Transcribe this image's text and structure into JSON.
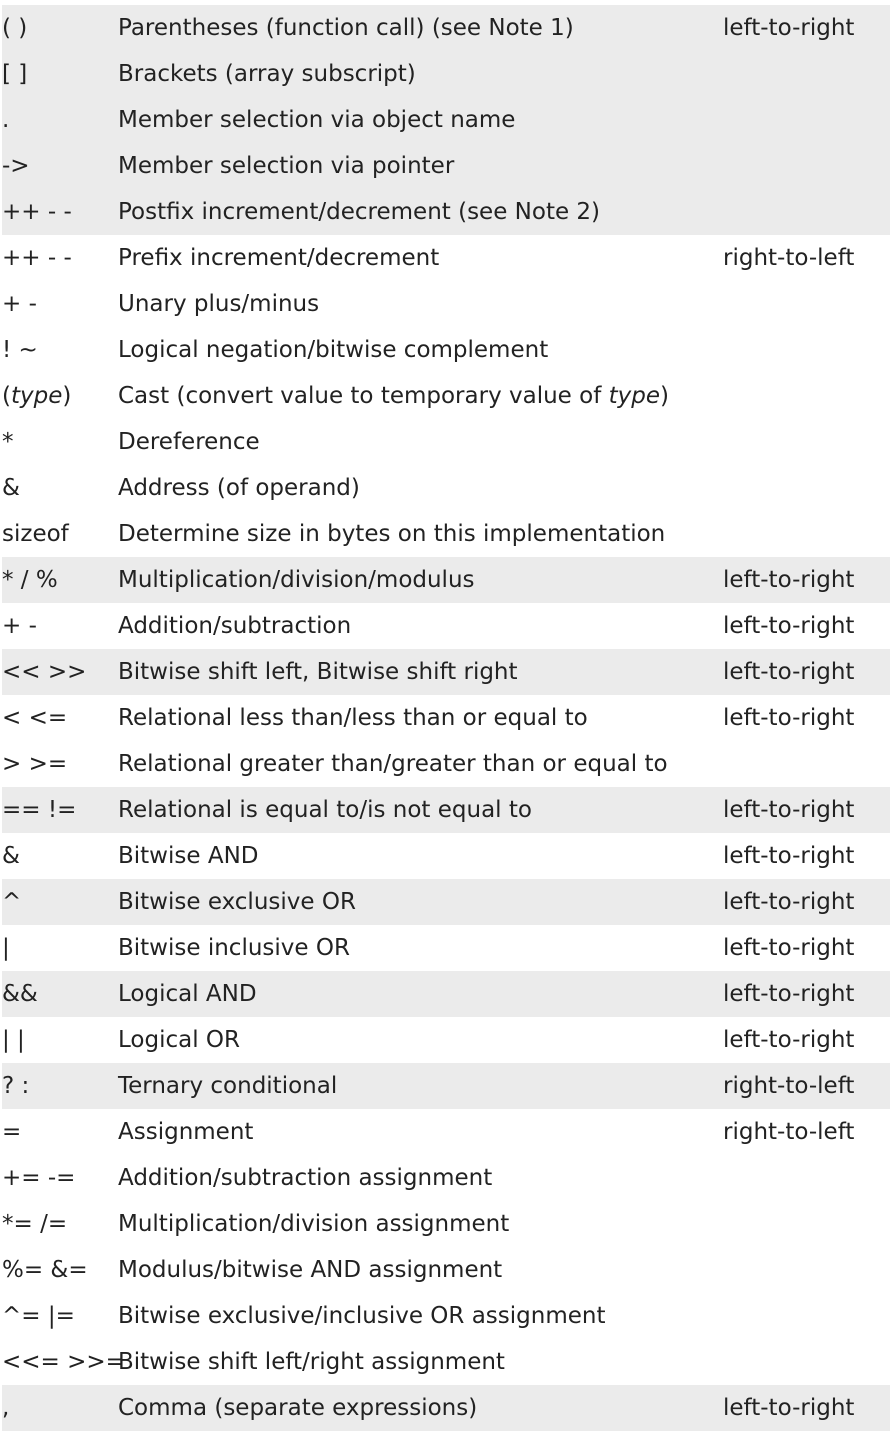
{
  "rows": [
    {
      "op": [
        {
          "t": "( )"
        }
      ],
      "desc": [
        {
          "t": "Parentheses (function call) (see Note 1)"
        }
      ],
      "assoc": "left-to-right",
      "shaded": true
    },
    {
      "op": [
        {
          "t": "[ ]"
        }
      ],
      "desc": [
        {
          "t": "Brackets (array subscript)"
        }
      ],
      "assoc": "",
      "shaded": true
    },
    {
      "op": [
        {
          "t": "."
        }
      ],
      "desc": [
        {
          "t": "Member selection via object name"
        }
      ],
      "assoc": "",
      "shaded": true
    },
    {
      "op": [
        {
          "t": "->"
        }
      ],
      "desc": [
        {
          "t": "Member selection via pointer"
        }
      ],
      "assoc": "",
      "shaded": true
    },
    {
      "op": [
        {
          "t": "++ - -"
        }
      ],
      "desc": [
        {
          "t": "Postfix increment/decrement (see Note 2)"
        }
      ],
      "assoc": "",
      "shaded": true
    },
    {
      "op": [
        {
          "t": "++ - -"
        }
      ],
      "desc": [
        {
          "t": "Prefix increment/decrement"
        }
      ],
      "assoc": "right-to-left",
      "shaded": false
    },
    {
      "op": [
        {
          "t": "+ -"
        }
      ],
      "desc": [
        {
          "t": "Unary plus/minus"
        }
      ],
      "assoc": "",
      "shaded": false
    },
    {
      "op": [
        {
          "t": "! ~"
        }
      ],
      "desc": [
        {
          "t": "Logical negation/bitwise complement"
        }
      ],
      "assoc": "",
      "shaded": false
    },
    {
      "op": [
        {
          "t": "("
        },
        {
          "t": "type",
          "i": true
        },
        {
          "t": ")"
        }
      ],
      "desc": [
        {
          "t": "Cast (convert value to temporary value of "
        },
        {
          "t": "type",
          "i": true
        },
        {
          "t": ")"
        }
      ],
      "assoc": "",
      "shaded": false
    },
    {
      "op": [
        {
          "t": "*"
        }
      ],
      "desc": [
        {
          "t": "Dereference"
        }
      ],
      "assoc": "",
      "shaded": false
    },
    {
      "op": [
        {
          "t": "&"
        }
      ],
      "desc": [
        {
          "t": "Address (of operand)"
        }
      ],
      "assoc": "",
      "shaded": false
    },
    {
      "op": [
        {
          "t": "sizeof"
        }
      ],
      "desc": [
        {
          "t": "Determine size in bytes on this implementation"
        }
      ],
      "assoc": "",
      "shaded": false
    },
    {
      "op": [
        {
          "t": "* / %"
        }
      ],
      "desc": [
        {
          "t": "Multiplication/division/modulus"
        }
      ],
      "assoc": "left-to-right",
      "shaded": true
    },
    {
      "op": [
        {
          "t": "+ -"
        }
      ],
      "desc": [
        {
          "t": "Addition/subtraction"
        }
      ],
      "assoc": "left-to-right",
      "shaded": false
    },
    {
      "op": [
        {
          "t": "<< >>"
        }
      ],
      "desc": [
        {
          "t": "Bitwise shift left, Bitwise shift right"
        }
      ],
      "assoc": "left-to-right",
      "shaded": true
    },
    {
      "op": [
        {
          "t": "< <="
        }
      ],
      "desc": [
        {
          "t": "Relational less than/less than or equal to"
        }
      ],
      "assoc": "left-to-right",
      "shaded": false
    },
    {
      "op": [
        {
          "t": "> >="
        }
      ],
      "desc": [
        {
          "t": "Relational greater than/greater  than or equal to"
        }
      ],
      "assoc": "",
      "shaded": false
    },
    {
      "op": [
        {
          "t": "== !="
        }
      ],
      "desc": [
        {
          "t": "Relational is equal to/is not equal to"
        }
      ],
      "assoc": "left-to-right",
      "shaded": true
    },
    {
      "op": [
        {
          "t": "&"
        }
      ],
      "desc": [
        {
          "t": "Bitwise AND"
        }
      ],
      "assoc": "left-to-right",
      "shaded": false
    },
    {
      "op": [
        {
          "t": "^"
        }
      ],
      "desc": [
        {
          "t": "Bitwise exclusive OR"
        }
      ],
      "assoc": "left-to-right",
      "shaded": true
    },
    {
      "op": [
        {
          "t": "|"
        }
      ],
      "desc": [
        {
          "t": "Bitwise inclusive OR"
        }
      ],
      "assoc": "left-to-right",
      "shaded": false
    },
    {
      "op": [
        {
          "t": "&&"
        }
      ],
      "desc": [
        {
          "t": "Logical AND"
        }
      ],
      "assoc": "left-to-right",
      "shaded": true
    },
    {
      "op": [
        {
          "t": "| |"
        }
      ],
      "desc": [
        {
          "t": "Logical OR"
        }
      ],
      "assoc": "left-to-right",
      "shaded": false
    },
    {
      "op": [
        {
          "t": "? :"
        }
      ],
      "desc": [
        {
          "t": "Ternary conditional"
        }
      ],
      "assoc": "right-to-left",
      "shaded": true
    },
    {
      "op": [
        {
          "t": "="
        }
      ],
      "desc": [
        {
          "t": "Assignment"
        }
      ],
      "assoc": "right-to-left",
      "shaded": false
    },
    {
      "op": [
        {
          "t": "+= -="
        }
      ],
      "desc": [
        {
          "t": "Addition/subtraction assignment"
        }
      ],
      "assoc": "",
      "shaded": false
    },
    {
      "op": [
        {
          "t": "*= /="
        }
      ],
      "desc": [
        {
          "t": "Multiplication/division assignment"
        }
      ],
      "assoc": "",
      "shaded": false
    },
    {
      "op": [
        {
          "t": "%= &="
        }
      ],
      "desc": [
        {
          "t": "Modulus/bitwise AND assignment"
        }
      ],
      "assoc": "",
      "shaded": false
    },
    {
      "op": [
        {
          "t": "^= |="
        }
      ],
      "desc": [
        {
          "t": "Bitwise exclusive/inclusive OR assignment"
        }
      ],
      "assoc": "",
      "shaded": false
    },
    {
      "op": [
        {
          "t": "<<= >>="
        }
      ],
      "desc": [
        {
          "t": "Bitwise shift left/right assignment"
        }
      ],
      "assoc": "",
      "shaded": false
    },
    {
      "op": [
        {
          "t": ","
        }
      ],
      "desc": [
        {
          "t": "Comma (separate expressions)"
        }
      ],
      "assoc": "left-to-right",
      "shaded": true
    }
  ]
}
